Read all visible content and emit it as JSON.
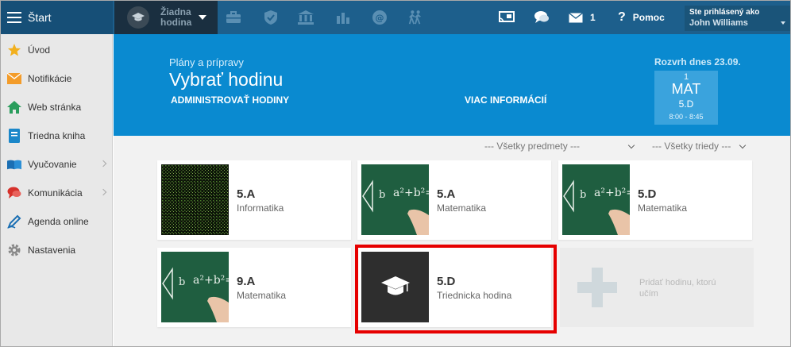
{
  "topbar": {
    "start_label": "Štart",
    "hour_selector_label": "Žiadna hodina",
    "messages_count": "1",
    "help_label": "Pomoc",
    "logged_in_title": "Ste prihlásený ako",
    "logged_in_user": "John Williams"
  },
  "sidebar": {
    "items": [
      {
        "label": "Úvod",
        "icon": "star-icon"
      },
      {
        "label": "Notifikácie",
        "icon": "envelope-icon"
      },
      {
        "label": "Web stránka",
        "icon": "home-icon"
      },
      {
        "label": "Triedna kniha",
        "icon": "book-icon"
      },
      {
        "label": "Vyučovanie",
        "icon": "open-book-icon",
        "has_submenu": true
      },
      {
        "label": "Komunikácia",
        "icon": "chat-icon",
        "has_submenu": true
      },
      {
        "label": "Agenda online",
        "icon": "pen-icon"
      },
      {
        "label": "Nastavenia",
        "icon": "gear-icon"
      }
    ]
  },
  "hero": {
    "subtitle": "Plány a prípravy",
    "title": "Vybrať hodinu",
    "admin_link": "ADMINISTROVAŤ HODINY",
    "more_info_link": "VIAC INFORMÁCIÍ",
    "schedule_title": "Rozvrh dnes 23.09.",
    "schedule": {
      "lesson_number": "1",
      "subject": "MAT",
      "class": "5.D",
      "time": "8:00 - 8:45"
    }
  },
  "filters": {
    "subjects": "--- Všetky predmety ---",
    "classes": "--- Všetky triedy ---"
  },
  "cards": [
    {
      "class": "5.A",
      "subject": "Informatika",
      "thumb": "matrix"
    },
    {
      "class": "5.A",
      "subject": "Matematika",
      "thumb": "chalkboard"
    },
    {
      "class": "5.D",
      "subject": "Matematika",
      "thumb": "chalkboard"
    },
    {
      "class": "9.A",
      "subject": "Matematika",
      "thumb": "chalkboard"
    },
    {
      "class": "5.D",
      "subject": "Triednicka hodina",
      "thumb": "graduation-cap"
    }
  ],
  "add_card": {
    "label": "Pridať hodinu, ktorú učím"
  },
  "colors": {
    "topbar": "#1d5f8c",
    "hero": "#0a8ad0",
    "highlight": "#e60000"
  }
}
